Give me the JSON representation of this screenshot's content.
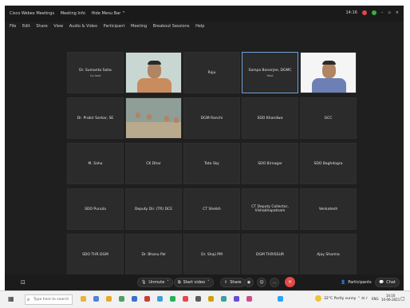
{
  "window": {
    "title": "Cisco Webex Meetings",
    "meeting_info": "Meeting Info",
    "hide_menu_bar": "Hide Menu Bar ^",
    "time": "14:16"
  },
  "menu": [
    "File",
    "Edit",
    "Share",
    "View",
    "Audio & Video",
    "Participant",
    "Meeting",
    "Breakout Sessions",
    "Help"
  ],
  "participants": [
    {
      "name": "Dr. Sumanta Saha",
      "subtitle": "Co-host",
      "video": false
    },
    {
      "name": "",
      "video": true,
      "type": "man1"
    },
    {
      "name": "Raju",
      "video": false
    },
    {
      "name": "Sampa Banerjee, DGMC",
      "subtitle": "Host",
      "video": false,
      "active": true
    },
    {
      "name": "",
      "video": true,
      "type": "man2"
    },
    {
      "name": "Dr. Prabir Sarkar, SE",
      "video": false
    },
    {
      "name": "",
      "video": true,
      "type": "room"
    },
    {
      "name": "DGM Ranchi",
      "video": false
    },
    {
      "name": "SDO Khandwa",
      "video": false
    },
    {
      "name": "GCC",
      "video": false
    },
    {
      "name": "M. Sahu",
      "video": false
    },
    {
      "name": "CK Dhar",
      "video": false
    },
    {
      "name": "Tata Sky",
      "video": false
    },
    {
      "name": "SDO Birnagar",
      "video": false
    },
    {
      "name": "SDO Baghdogra",
      "video": false
    },
    {
      "name": "SDO Purulia",
      "video": false
    },
    {
      "name": "Deputy Dir. (TR) DCE",
      "video": false
    },
    {
      "name": "CT Sheikh",
      "video": false
    },
    {
      "name": "CT Deputy Collector, Vishakhapatnam",
      "video": false
    },
    {
      "name": "Venkatesh",
      "video": false
    },
    {
      "name": "SDO THR DGM",
      "video": false
    },
    {
      "name": "Dr. Bhanu Pal",
      "video": false
    },
    {
      "name": "Dr. Shaji PM",
      "video": false
    },
    {
      "name": "DGM THRISSUR",
      "video": false
    },
    {
      "name": "Ajay Sharma",
      "video": false
    }
  ],
  "controls": {
    "unmute": "Unmute",
    "start_video": "Start video",
    "share": "Share",
    "participants": "Participants",
    "chat": "Chat"
  },
  "taskbar": {
    "search_placeholder": "Type here to search",
    "weather": "32°C Partly sunny",
    "clock_time": "14:16",
    "clock_date": "10-06-2021",
    "lang": "ENG"
  },
  "colors": {
    "leave": "#e54848",
    "active_border": "#6fa3d8"
  }
}
